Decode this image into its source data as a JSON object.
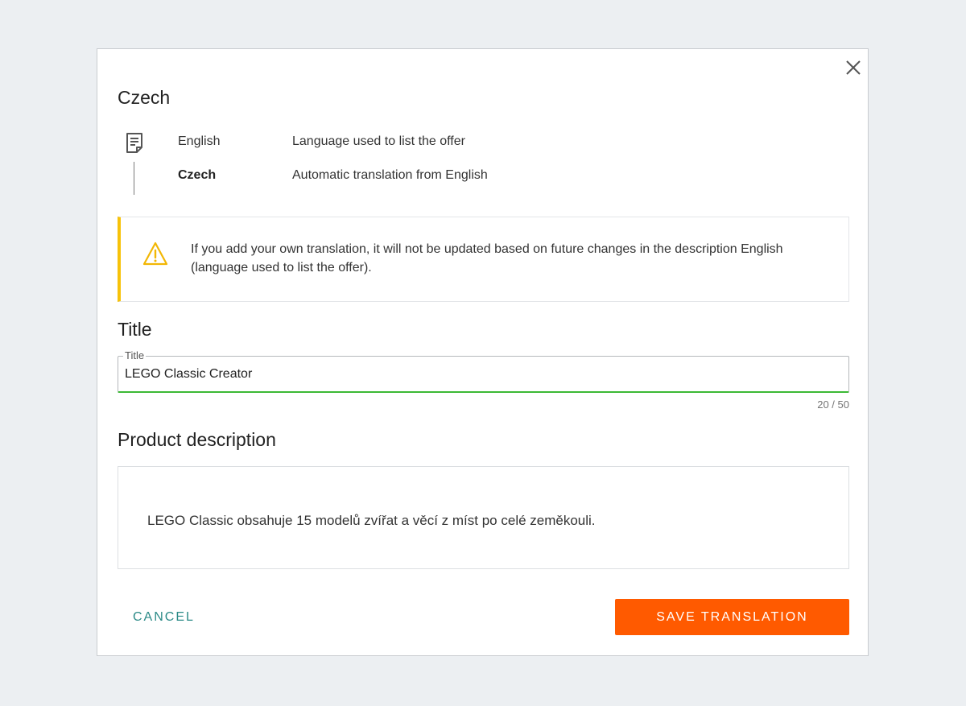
{
  "dialog": {
    "title": "Czech",
    "close_icon": "close-icon"
  },
  "languages": {
    "icon": "document-icon",
    "rows": [
      {
        "name": "English",
        "description": "Language used to list the offer"
      },
      {
        "name": "Czech",
        "description": "Automatic translation from English"
      }
    ]
  },
  "alert": {
    "icon": "warning-icon",
    "accent_color": "#f7c20a",
    "text": "If you add your own translation, it will not be updated based on future changes in the description English (language used to list the offer)."
  },
  "title_section": {
    "heading": "Title",
    "field_label": "Title",
    "value": "LEGO Classic Creator",
    "counter": "20  /  50",
    "focus_color": "#3cb935"
  },
  "description_section": {
    "heading": "Product description",
    "text": "LEGO Classic obsahuje 15 modelů zvířat a věcí z míst po celé zeměkouli."
  },
  "actions": {
    "cancel_label": "CANCEL",
    "save_label": "SAVE TRANSLATION",
    "cancel_color": "#2b8a87",
    "save_color": "#ff5a00"
  }
}
